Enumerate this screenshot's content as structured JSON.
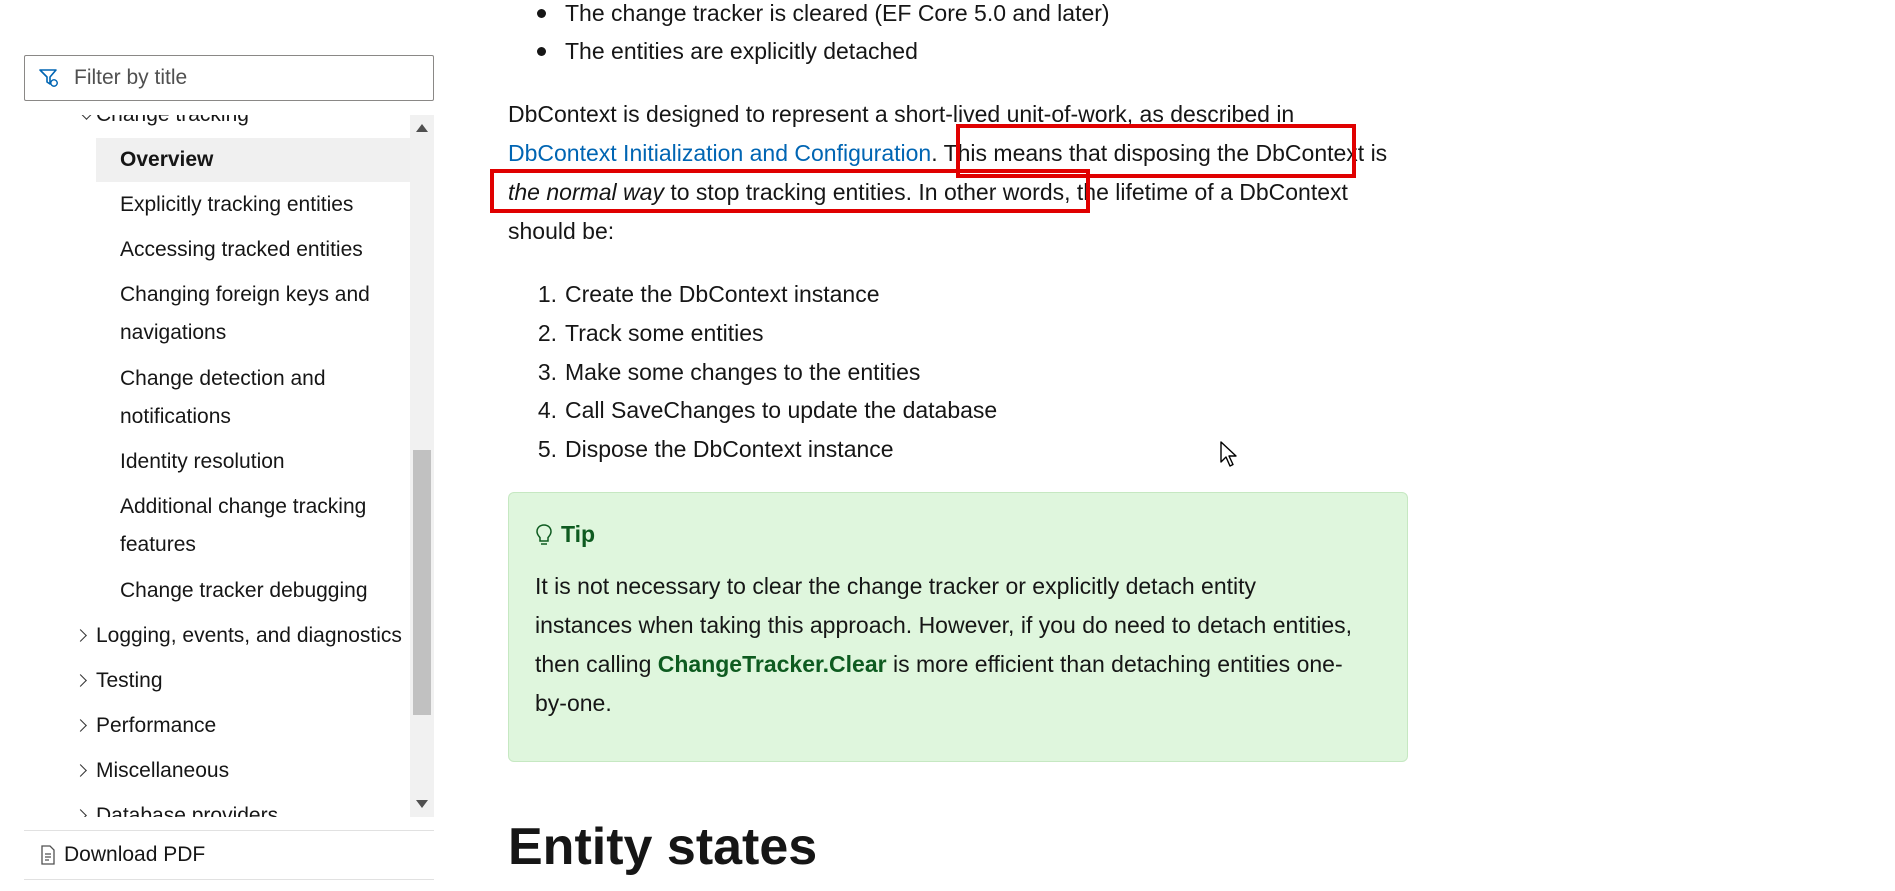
{
  "sidebar": {
    "filter_placeholder": "Filter by title",
    "toc": {
      "parent_label": "Change tracking",
      "children": [
        "Overview",
        "Explicitly tracking entities",
        "Accessing tracked entities",
        "Changing foreign keys and navigations",
        "Change detection and notifications",
        "Identity resolution",
        "Additional change tracking features",
        "Change tracker debugging"
      ],
      "siblings": [
        "Logging, events, and diagnostics",
        "Testing",
        "Performance",
        "Miscellaneous",
        "Database providers"
      ]
    },
    "download_label": "Download PDF"
  },
  "content": {
    "bullets": [
      "The change tracker is cleared (EF Core 5.0 and later)",
      "The entities are explicitly detached"
    ],
    "para": {
      "p1": "DbContext is designed to represent a short-lived unit-of-work, as described in ",
      "link": "DbContext Initialization and Configuration",
      "p2": ". This means that disposing the DbContext is ",
      "em": "the normal way",
      "p3": " to stop tracking entities. In other words, the lifetime of a DbContext should be:"
    },
    "steps": [
      "Create the DbContext instance",
      "Track some entities",
      "Make some changes to the entities",
      "Call SaveChanges to update the database",
      "Dispose the DbContext instance"
    ],
    "step_numbers": [
      "1.",
      "2.",
      "3.",
      "4.",
      "5."
    ],
    "tip": {
      "title": "Tip",
      "text_before": "It is not necessary to clear the change tracker or explicitly detach entity instances when taking this approach. However, if you do need to detach entities, then calling ",
      "code": "ChangeTracker.Clear",
      "text_after": " is more efficient than detaching entities one-by-one."
    },
    "section_heading": "Entity states"
  },
  "colors": {
    "link": "#0065b3",
    "tip_bg": "#dff6dd",
    "tip_accent": "#0e5b20",
    "highlight": "#e00000"
  }
}
